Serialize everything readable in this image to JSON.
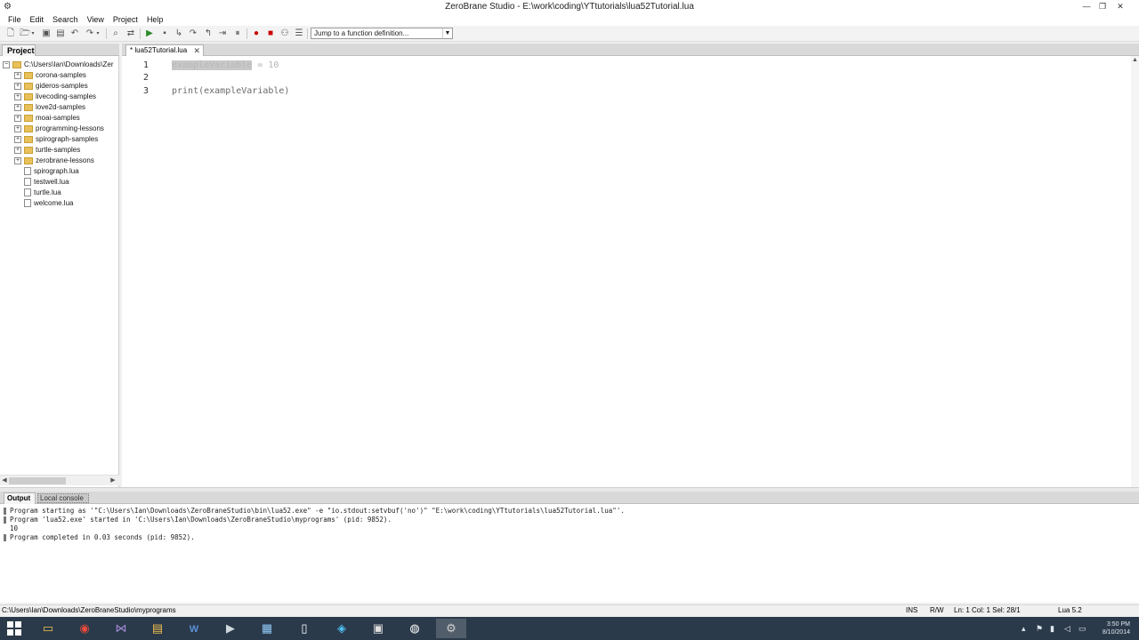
{
  "window": {
    "title": "ZeroBrane Studio - E:\\work\\coding\\YTtutorials\\lua52Tutorial.lua"
  },
  "menu": [
    "File",
    "Edit",
    "Search",
    "View",
    "Project",
    "Help"
  ],
  "toolbar": {
    "jump_placeholder": "Jump to a function definition..."
  },
  "project": {
    "tab_label": "Project",
    "root": "C:\\Users\\Ian\\Downloads\\Zer",
    "folders": [
      "corona-samples",
      "gideros-samples",
      "livecoding-samples",
      "love2d-samples",
      "moai-samples",
      "programming-lessons",
      "spirograph-samples",
      "turtle-samples",
      "zerobrane-lessons"
    ],
    "files": [
      "spirograph.lua",
      "testwell.lua",
      "turtle.lua",
      "welcome.lua"
    ]
  },
  "editor": {
    "tab_label": "* lua52Tutorial.lua",
    "lines": [
      {
        "num": "1",
        "selected": "exampleVariable",
        "rest": " = 10"
      },
      {
        "num": "2",
        "text": ""
      },
      {
        "num": "3",
        "text": "print(exampleVariable)"
      }
    ]
  },
  "output": {
    "tabs": [
      "Output",
      "Local console"
    ],
    "lines": [
      {
        "marker": true,
        "text": "Program starting as '\"C:\\Users\\Ian\\Downloads\\ZeroBraneStudio\\bin\\lua52.exe\" -e \"io.stdout:setvbuf('no')\" \"E:\\work\\coding\\YTtutorials\\lua52Tutorial.lua\"'."
      },
      {
        "marker": true,
        "text": "Program 'lua52.exe' started in 'C:\\Users\\Ian\\Downloads\\ZeroBraneStudio\\myprograms' (pid: 9852)."
      },
      {
        "marker": false,
        "text": "10"
      },
      {
        "marker": true,
        "text": "Program completed in 0.03 seconds (pid: 9852)."
      }
    ]
  },
  "statusbar": {
    "path": "C:\\Users\\Ian\\Downloads\\ZeroBraneStudio\\myprograms",
    "ins": "INS",
    "rw": "R/W",
    "position": "Ln: 1 Col: 1 Sel: 28/1",
    "interpreter": "Lua 5.2"
  },
  "taskbar": {
    "apps": [
      "file-explorer",
      "chrome",
      "visual-studio",
      "folder-app",
      "word",
      "terminal",
      "calculator",
      "notepad",
      "network-app",
      "files-app",
      "obs",
      "zerobrane"
    ],
    "clock": {
      "time": "3:50 PM",
      "date": "8/10/2014"
    }
  }
}
